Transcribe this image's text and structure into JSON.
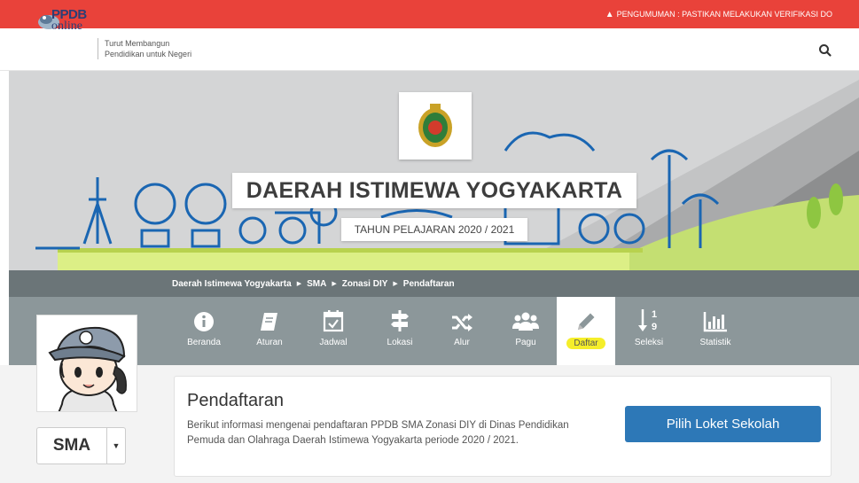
{
  "announcement": {
    "icon": "warning-icon",
    "text": "PENGUMUMAN : PASTIKAN MELAKUKAN VERIFIKASI DO"
  },
  "header": {
    "logo_top": "PPDB",
    "logo_bottom": "online",
    "tagline_line1": "Turut Membangun",
    "tagline_line2": "Pendidikan untuk Negeri",
    "search_icon": "search-icon"
  },
  "banner": {
    "title": "DAERAH ISTIMEWA YOGYAKARTA",
    "subtitle": "TAHUN PELAJARAN 2020 / 2021"
  },
  "breadcrumb": [
    "Daerah Istimewa Yogyakarta",
    "SMA",
    "Zonasi DIY",
    "Pendaftaran"
  ],
  "menu": [
    {
      "label": "Beranda",
      "icon": "info-icon",
      "active": false
    },
    {
      "label": "Aturan",
      "icon": "book-icon",
      "active": false
    },
    {
      "label": "Jadwal",
      "icon": "calendar-check-icon",
      "active": false
    },
    {
      "label": "Lokasi",
      "icon": "signpost-icon",
      "active": false
    },
    {
      "label": "Alur",
      "icon": "shuffle-icon",
      "active": false
    },
    {
      "label": "Pagu",
      "icon": "users-icon",
      "active": false
    },
    {
      "label": "Daftar",
      "icon": "pencil-icon",
      "active": true
    },
    {
      "label": "Seleksi",
      "icon": "sort-numeric-icon",
      "active": false
    },
    {
      "label": "Statistik",
      "icon": "bar-chart-icon",
      "active": false
    }
  ],
  "level_select": {
    "value": "SMA"
  },
  "card": {
    "title": "Pendaftaran",
    "description": "Berikut informasi mengenai pendaftaran PPDB SMA Zonasi DIY di Dinas Pendidikan Pemuda dan Olahraga Daerah Istimewa Yogyakarta periode 2020 / 2021.",
    "button": "Pilih Loket Sekolah"
  },
  "colors": {
    "announce": "#e9423a",
    "primary": "#2d78b7",
    "menu": "#8c979a",
    "crumb": "#6b7578",
    "highlight": "#f5ee2a"
  }
}
